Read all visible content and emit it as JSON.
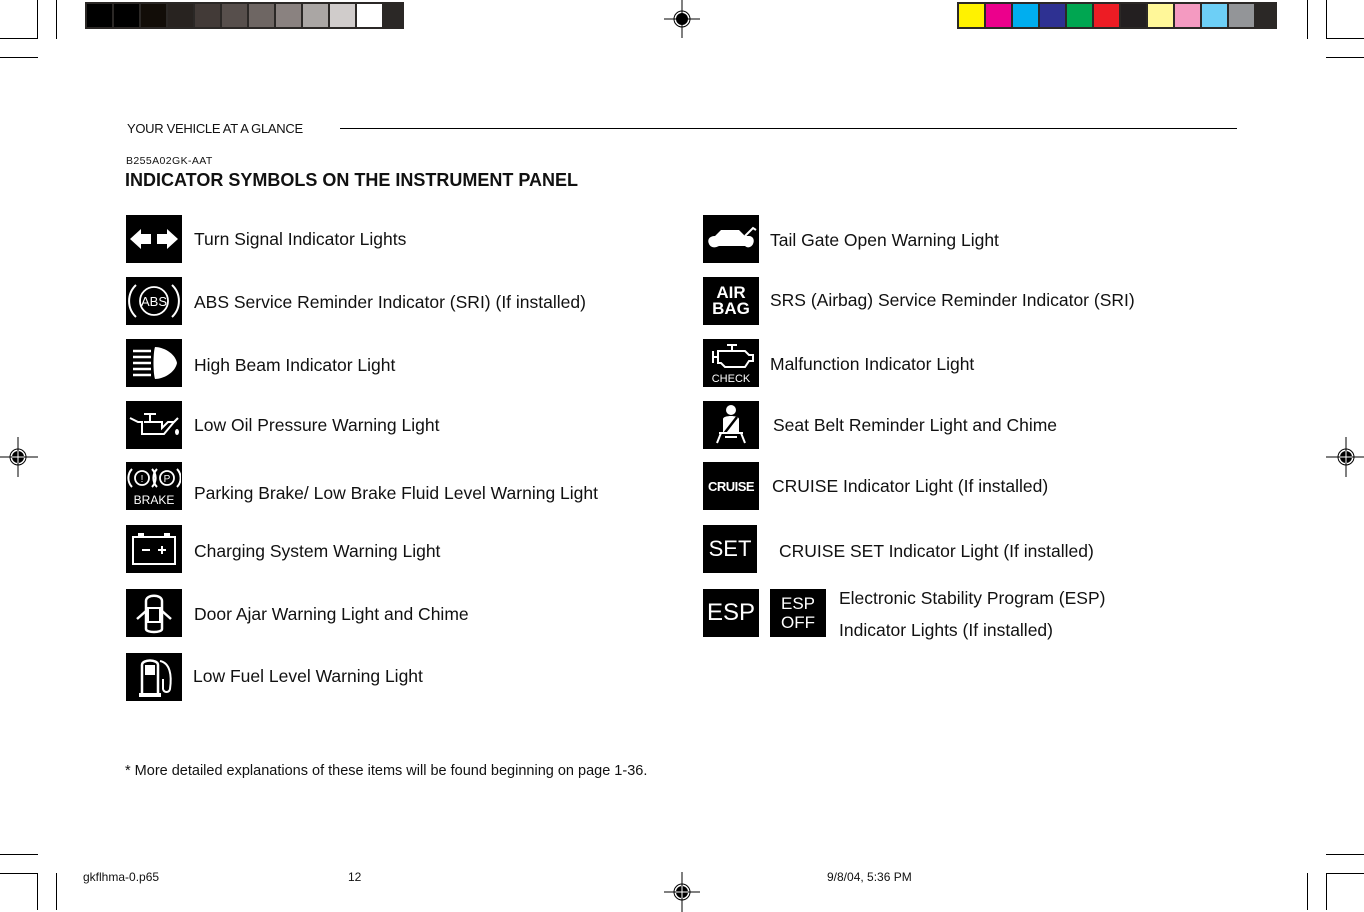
{
  "print_marks": {
    "grayscale_swatches": [
      "#000000",
      "#000000",
      "#120d08",
      "#282320",
      "#423a37",
      "#574f4c",
      "#6e6663",
      "#8a8280",
      "#aaa6a4",
      "#d0cccb",
      "#ffffff"
    ],
    "color_swatches": [
      "#fff200",
      "#ec008c",
      "#00aeef",
      "#2e3192",
      "#00a651",
      "#ed1c24",
      "#231f20",
      "#fff799",
      "#f49ac1",
      "#6dcff6",
      "#939598"
    ]
  },
  "header": {
    "section": "YOUR VEHICLE AT A GLANCE",
    "code": "B255A02GK-AAT",
    "title": "INDICATOR SYMBOLS ON THE INSTRUMENT PANEL"
  },
  "left_items": [
    {
      "icon": "turn-signal-icon",
      "label": "Turn Signal Indicator Lights"
    },
    {
      "icon": "abs-icon",
      "label": "ABS Service Reminder Indicator (SRI) (If installed)",
      "icon_text": "ABS"
    },
    {
      "icon": "high-beam-icon",
      "label": "High Beam Indicator Light"
    },
    {
      "icon": "oil-pressure-icon",
      "label": "Low Oil Pressure Warning Light"
    },
    {
      "icon": "brake-icon",
      "label": "Parking Brake/ Low Brake Fluid Level Warning Light",
      "icon_text": "BRAKE"
    },
    {
      "icon": "battery-icon",
      "label": "Charging System Warning Light"
    },
    {
      "icon": "door-ajar-icon",
      "label": "Door Ajar Warning Light and Chime"
    },
    {
      "icon": "fuel-icon",
      "label": "Low Fuel Level Warning Light"
    }
  ],
  "right_items": [
    {
      "icon": "tail-gate-icon",
      "label": "Tail Gate Open Warning Light"
    },
    {
      "icon": "airbag-icon",
      "label": "SRS (Airbag) Service Reminder Indicator (SRI)",
      "icon_text_1": "AIR",
      "icon_text_2": "BAG"
    },
    {
      "icon": "check-engine-icon",
      "label": "Malfunction Indicator Light",
      "icon_text": "CHECK"
    },
    {
      "icon": "seat-belt-icon",
      "label": "Seat Belt Reminder Light and Chime"
    },
    {
      "icon": "cruise-icon",
      "label": "CRUISE Indicator Light (If installed)",
      "icon_text": "CRUISE"
    },
    {
      "icon": "set-icon",
      "label": "CRUISE SET Indicator Light (If installed)",
      "icon_text": "SET"
    },
    {
      "icon": "esp-icon",
      "label_1": "Electronic Stability Program (ESP)",
      "label_2": "Indicator Lights (If installed)",
      "icon_text": "ESP",
      "icon2_text_1": "ESP",
      "icon2_text_2": "OFF"
    }
  ],
  "note": "* More detailed explanations of these items will be found beginning on page 1-36.",
  "footer": {
    "file": "gkflhma-0.p65",
    "page": "12",
    "timestamp": "9/8/04, 5:36 PM"
  }
}
